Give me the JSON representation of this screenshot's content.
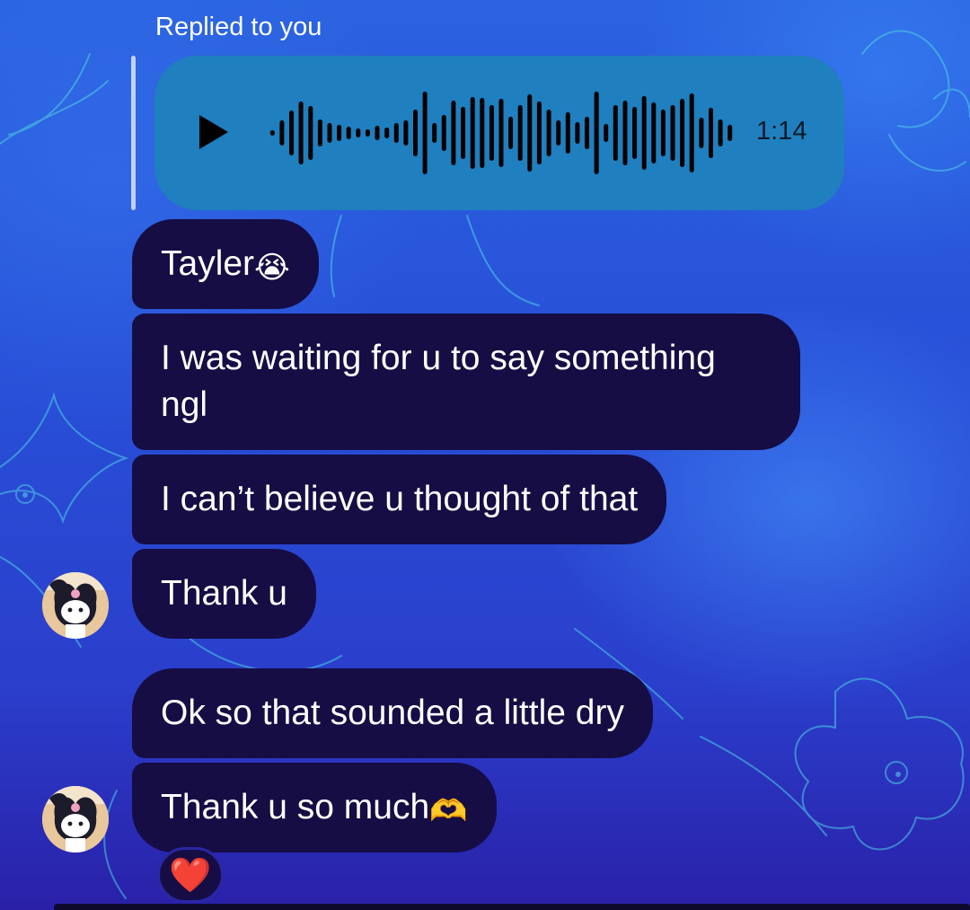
{
  "reply_label": "Replied to you",
  "voice_note": {
    "duration": "1:14",
    "play_icon": "play-icon"
  },
  "messages": [
    {
      "text": "Tayler",
      "emoji": "😭"
    },
    {
      "text": "I was waiting for u to say something ngl"
    },
    {
      "text": "I can’t believe u thought of that"
    },
    {
      "text": "Thank u"
    },
    {
      "text": "Ok so that sounded a little dry"
    },
    {
      "text": "Thank u so much",
      "emoji": "🫶"
    }
  ],
  "reaction": {
    "emoji": "❤️"
  },
  "colors": {
    "bubble": "#160d44",
    "voice_bubble": "#1f7fbf",
    "text": "#ffffff"
  }
}
